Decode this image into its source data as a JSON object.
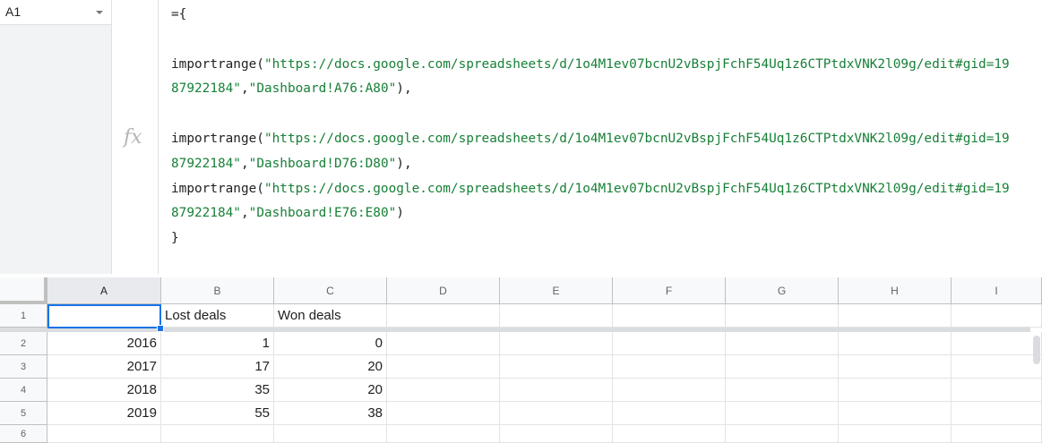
{
  "name_box": {
    "value": "A1"
  },
  "formula_bar": {
    "line1": "={",
    "line3a": "importrange(",
    "line3b": "\"https://docs.google.com/spreadsheets/d/1o4M1ev07bcnU2vBspjFchF54Uq1z6CTPtdxVNK2l09g/edit#gid=19",
    "line4a": "87922184\"",
    "line4b": ",",
    "line4c": "\"Dashboard!A76:A80\"",
    "line4d": "),",
    "line6a": "importrange(",
    "line6b": "\"https://docs.google.com/spreadsheets/d/1o4M1ev07bcnU2vBspjFchF54Uq1z6CTPtdxVNK2l09g/edit#gid=19",
    "line7a": "87922184\"",
    "line7b": ",",
    "line7c": "\"Dashboard!D76:D80\"",
    "line7d": "),",
    "line8a": "importrange(",
    "line8b": "\"https://docs.google.com/spreadsheets/d/1o4M1ev07bcnU2vBspjFchF54Uq1z6CTPtdxVNK2l09g/edit#gid=19",
    "line9a": "87922184\"",
    "line9b": ",",
    "line9c": "\"Dashboard!E76:E80\"",
    "line9d": ")",
    "line10": "}"
  },
  "columns": [
    "A",
    "B",
    "C",
    "D",
    "E",
    "F",
    "G",
    "H",
    "I"
  ],
  "rows": [
    {
      "num": "1",
      "cells": [
        "",
        "Lost deals",
        "Won deals",
        "",
        "",
        "",
        "",
        "",
        ""
      ]
    },
    {
      "num": "2",
      "cells": [
        "2016",
        "1",
        "0",
        "",
        "",
        "",
        "",
        "",
        ""
      ]
    },
    {
      "num": "3",
      "cells": [
        "2017",
        "17",
        "20",
        "",
        "",
        "",
        "",
        "",
        ""
      ]
    },
    {
      "num": "4",
      "cells": [
        "2018",
        "35",
        "20",
        "",
        "",
        "",
        "",
        "",
        ""
      ]
    },
    {
      "num": "5",
      "cells": [
        "2019",
        "55",
        "38",
        "",
        "",
        "",
        "",
        "",
        ""
      ]
    },
    {
      "num": "6",
      "cells": [
        "",
        "",
        "",
        "",
        "",
        "",
        "",
        "",
        ""
      ]
    }
  ],
  "colors": {
    "selection": "#1a73e8",
    "string_literal": "#188038"
  }
}
